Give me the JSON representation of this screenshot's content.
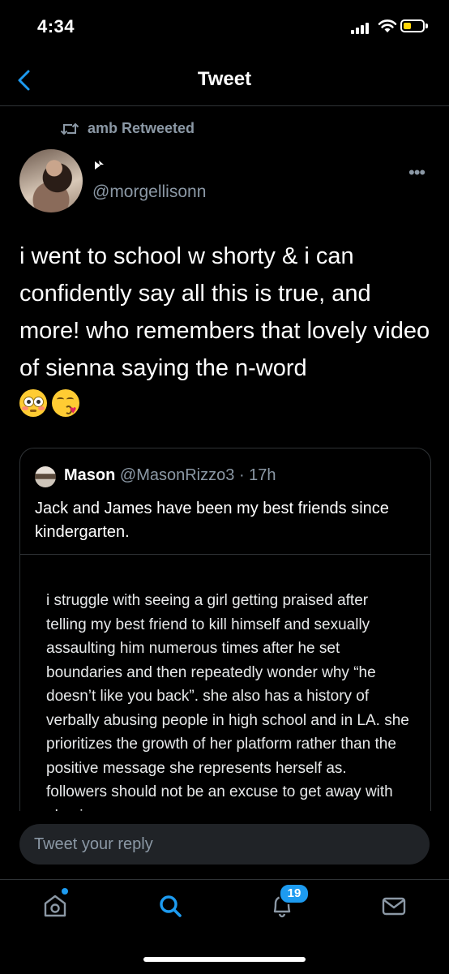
{
  "status_bar": {
    "time": "4:34"
  },
  "nav": {
    "title": "Tweet"
  },
  "retweet": {
    "label": "amb Retweeted"
  },
  "author": {
    "handle": "@morgellisonn",
    "avatar_icon": "avatar-photo"
  },
  "tweet": {
    "text": "i went to school w shorty & i can confidently say all this is true, and more! who remembers that lovely video of sienna saying the n-word",
    "emojis": [
      "flushed-face",
      "kissing-face-with-heart"
    ]
  },
  "quote": {
    "name": "Mason",
    "handle": "@MasonRizzo3",
    "separator": "·",
    "time": "17h",
    "text": "Jack and James have been my best friends since kindergarten.",
    "media_text": "i struggle with seeing a girl getting praised after telling my best friend to kill himself and sexually assaulting him numerous times after he set boundaries and then repeatedly wonder why “he doesn’t like you back”. she also has a history of verbally abusing people in high school and in LA. she prioritizes the growth of her platform rather than the positive message she represents herself as. followers should not be an excuse to get away with abusive"
  },
  "reply": {
    "placeholder": "Tweet your reply"
  },
  "tabs": {
    "notifications_badge": "19",
    "items": [
      "home-icon",
      "search-icon",
      "bell-icon",
      "mail-icon"
    ]
  },
  "colors": {
    "accent": "#1d9bf0",
    "muted": "#8b98a5",
    "background": "#000000",
    "border": "#2f3336"
  }
}
